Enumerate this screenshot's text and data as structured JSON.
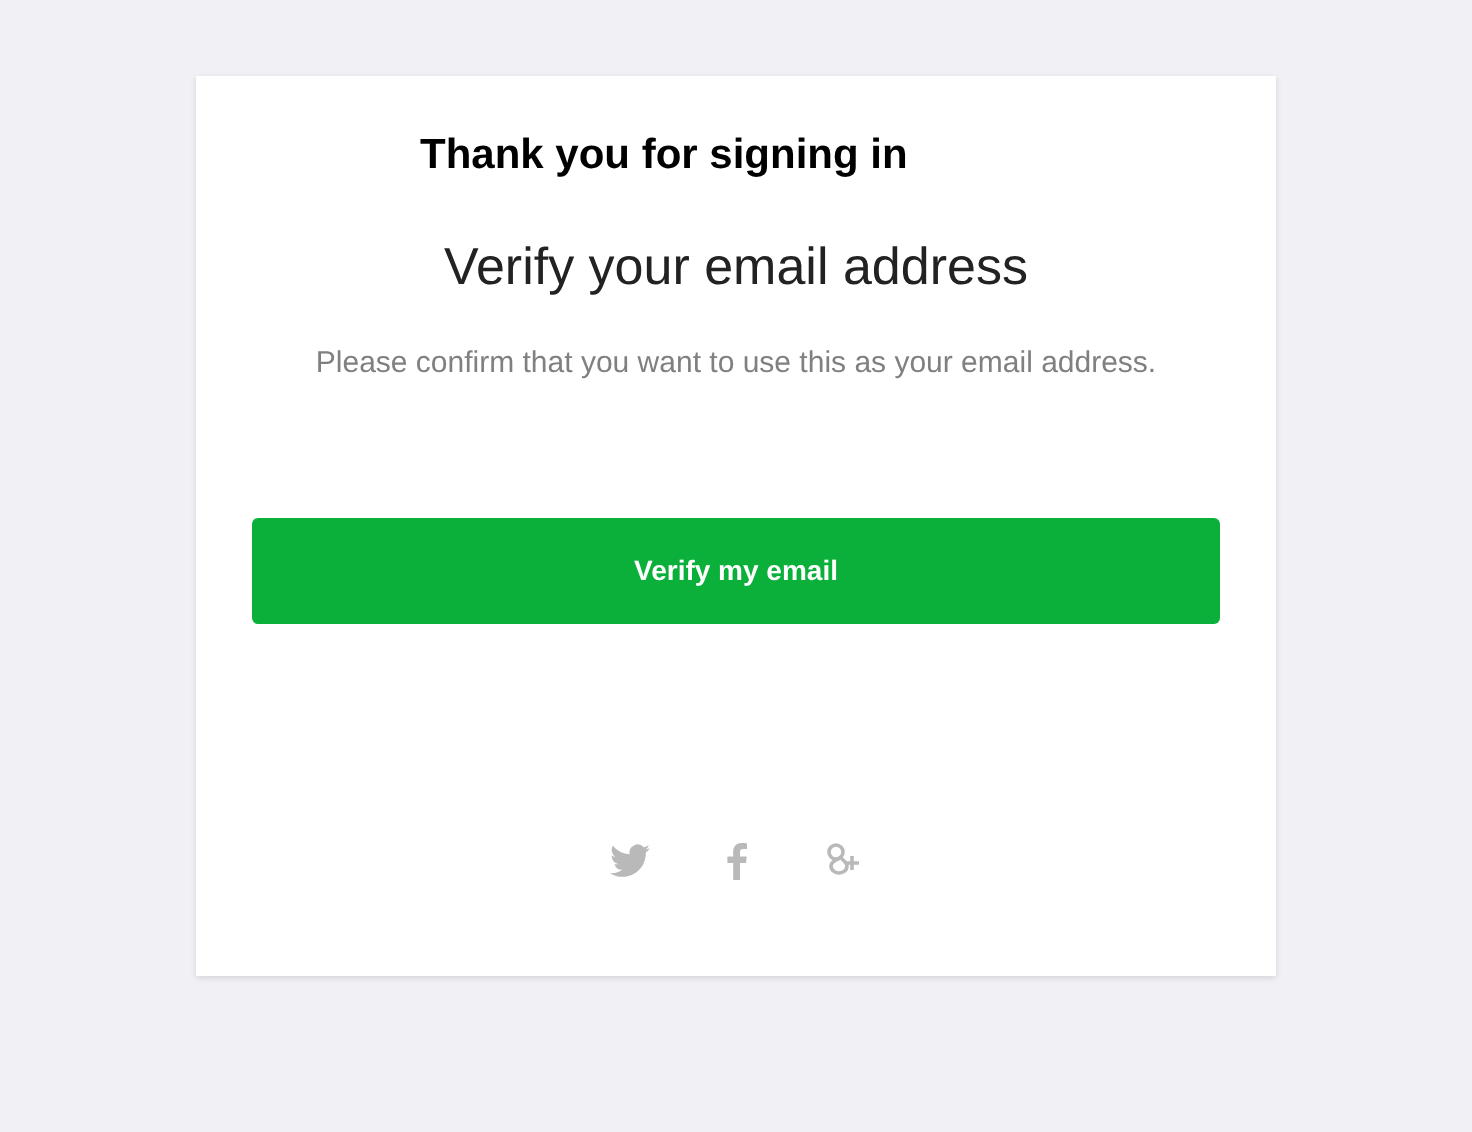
{
  "card": {
    "greeting": "Thank you for signing in",
    "heading": "Verify your email address",
    "message": "Please confirm that you want to use this as your email address.",
    "button": "Verify my email"
  }
}
